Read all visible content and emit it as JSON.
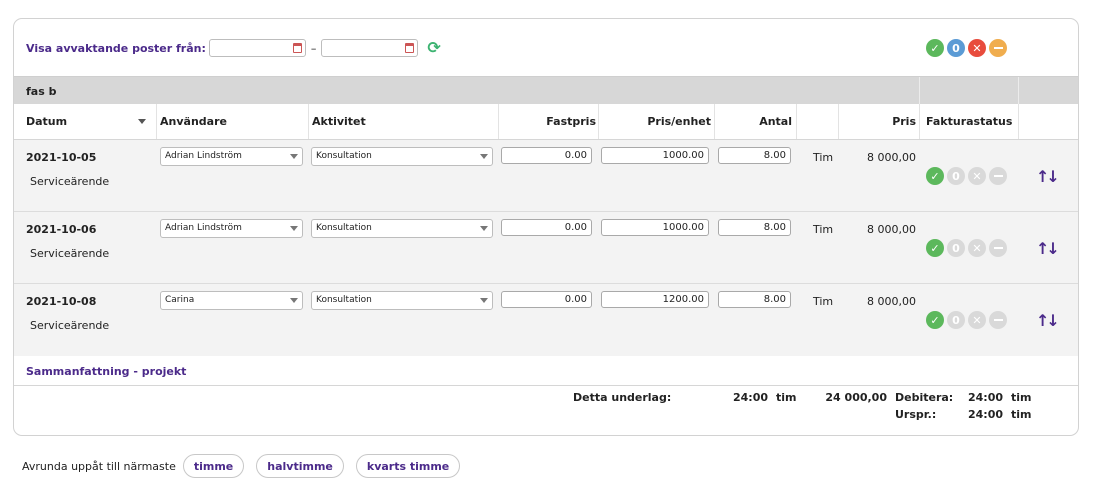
{
  "filter": {
    "label": "Visa avvaktande poster från:",
    "from_value": "",
    "to_value": "",
    "separator": "–"
  },
  "legend": {
    "approved": "",
    "count_symbol": "0",
    "rejected": "",
    "pending": ""
  },
  "phase": {
    "title": "fas b"
  },
  "columns": {
    "date": "Datum",
    "user": "Användare",
    "activity": "Aktivitet",
    "fixed_price": "Fastpris",
    "unit_price": "Pris/enhet",
    "quantity": "Antal",
    "price": "Pris",
    "invoice_status": "Fakturastatus"
  },
  "entries": [
    {
      "date": "2021-10-05",
      "description": "Serviceärende",
      "user": "Adrian Lindström",
      "activity": "Konsultation",
      "fixed_price": "0.00",
      "unit_price": "1000.00",
      "quantity": "8.00",
      "unit": "Tim",
      "price": "8 000,00",
      "status_count": "0"
    },
    {
      "date": "2021-10-06",
      "description": "Serviceärende",
      "user": "Adrian Lindström",
      "activity": "Konsultation",
      "fixed_price": "0.00",
      "unit_price": "1000.00",
      "quantity": "8.00",
      "unit": "Tim",
      "price": "8 000,00",
      "status_count": "0"
    },
    {
      "date": "2021-10-08",
      "description": "Serviceärende",
      "user": "Carina",
      "activity": "Konsultation",
      "fixed_price": "0.00",
      "unit_price": "1200.00",
      "quantity": "8.00",
      "unit": "Tim",
      "price": "8 000,00",
      "status_count": "0"
    }
  ],
  "summary": {
    "title": "Sammanfattning - projekt",
    "basis_label": "Detta underlag:",
    "basis_hours": "24:00",
    "basis_unit": "tim",
    "basis_amount": "24 000,00",
    "debit_label": "Debitera:",
    "debit_hours": "24:00",
    "debit_unit": "tim",
    "orig_label": "Urspr.:",
    "orig_hours": "24:00",
    "orig_unit": "tim"
  },
  "rounding": {
    "label": "Avrunda uppåt till närmaste",
    "options": [
      "timme",
      "halvtimme",
      "kvarts timme"
    ]
  },
  "colors": {
    "accent": "#4b2a8a",
    "approved": "#5cb85c",
    "count": "#5b9bd5",
    "rejected": "#e84c3d",
    "pending": "#f0ad4e",
    "inactive": "#d9d9d9"
  }
}
